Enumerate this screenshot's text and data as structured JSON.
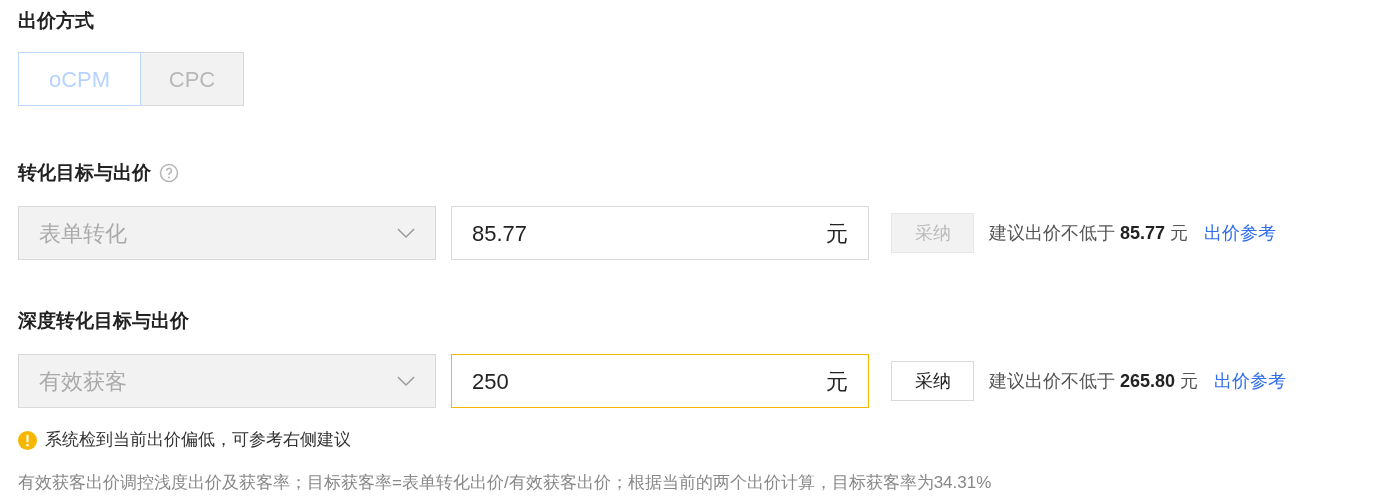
{
  "bid_method": {
    "title": "出价方式",
    "disabled": true,
    "options": [
      {
        "label": "oCPM",
        "selected": true
      },
      {
        "label": "CPC",
        "selected": false
      }
    ]
  },
  "goals": [
    {
      "title": "转化目标与出价",
      "help_icon": true,
      "select": {
        "value": "表单转化",
        "disabled": true
      },
      "bid": {
        "value": "85.77",
        "unit": "元",
        "warning": false
      },
      "adopt": {
        "label": "采纳",
        "disabled": true
      },
      "suggestion": "建议出价不低于 **85.77** 元",
      "link": "出价参考"
    },
    {
      "title": "深度转化目标与出价",
      "help_icon": false,
      "select": {
        "value": "有效获客",
        "disabled": true
      },
      "bid": {
        "value": "250",
        "unit": "元",
        "warning": true
      },
      "adopt": {
        "label": "采纳",
        "disabled": false
      },
      "suggestion": "建议出价不低于 **265.80** 元",
      "link": "出价参考"
    }
  ],
  "warning": "系统检到当前出价偏低，可参考右侧建议",
  "note": "有效获客出价调控浅度出价及获客率；目标获客率=表单转化出价/有效获客出价；根据当前的两个出价计算，目标获客率为34.31%"
}
